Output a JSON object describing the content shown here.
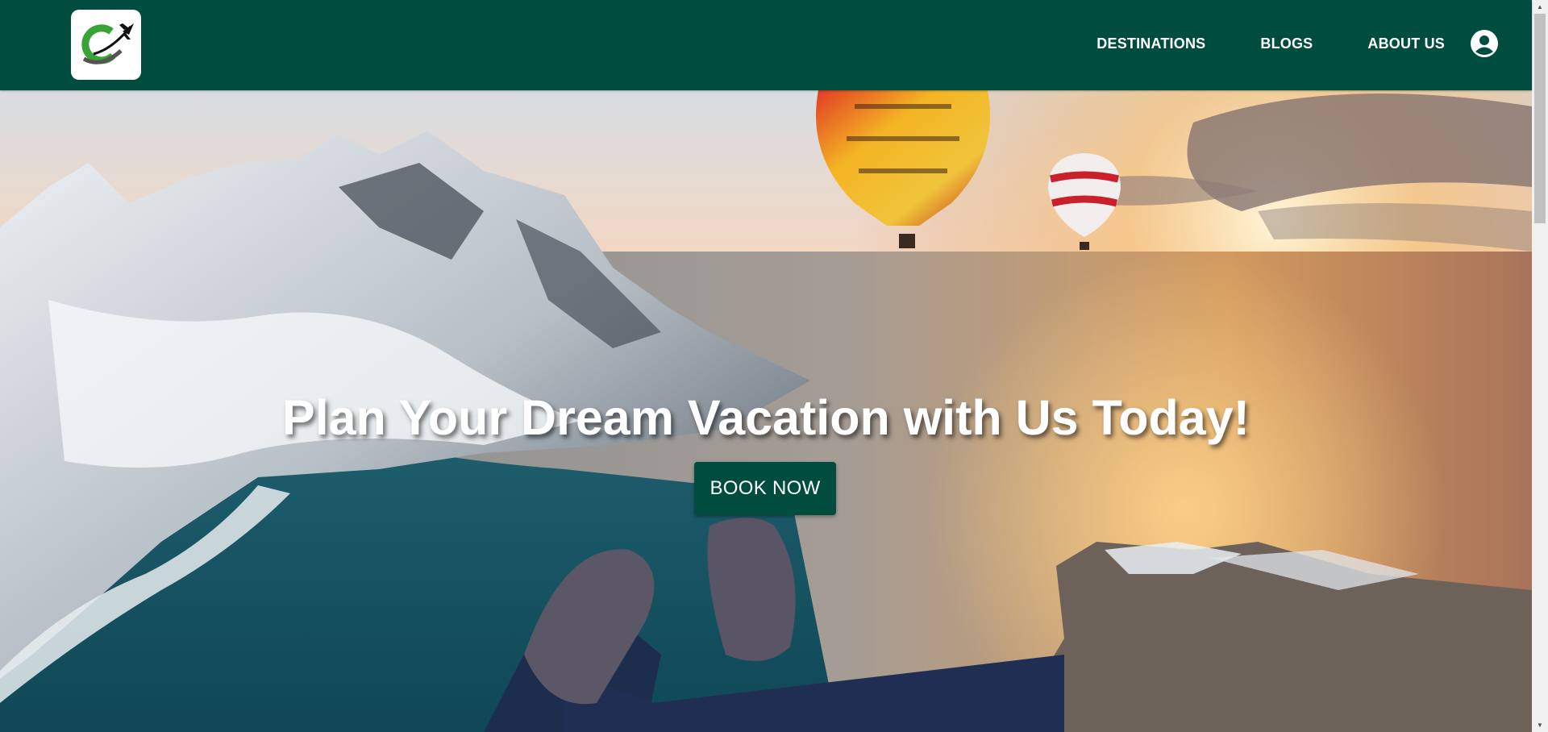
{
  "nav": {
    "logo_name": "travel-plane-logo",
    "links": [
      "DESTINATIONS",
      "BLOGS",
      "ABOUT US"
    ],
    "user_icon": "account-circle-icon"
  },
  "hero": {
    "title": "Plan Your Dream Vacation with Us Today!",
    "button_label": "BOOK NOW"
  },
  "colors": {
    "brand": "#004d40",
    "text_light": "#ffffff"
  }
}
